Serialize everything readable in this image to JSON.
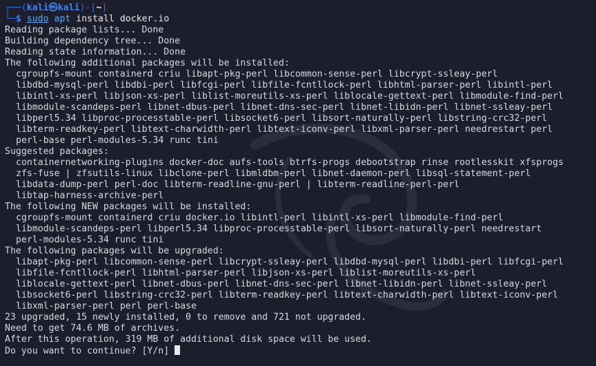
{
  "prompt": {
    "corner_top": "┌──(",
    "user": "kali",
    "at": "㉿",
    "host": "kali",
    "sep": ")-[",
    "dir": "~",
    "close": "]",
    "corner_bottom": "└─",
    "dollar": "$"
  },
  "command": {
    "sudo": "sudo",
    "apt": "apt",
    "rest": "install docker.io"
  },
  "output_lines": [
    {
      "text": "Reading package lists... Done",
      "indent": false
    },
    {
      "text": "Building dependency tree... Done",
      "indent": false
    },
    {
      "text": "Reading state information... Done",
      "indent": false
    },
    {
      "text": "The following additional packages will be installed:",
      "indent": false
    },
    {
      "text": "cgroupfs-mount containerd criu libapt-pkg-perl libcommon-sense-perl libcrypt-ssleay-perl",
      "indent": true
    },
    {
      "text": "libdbd-mysql-perl libdbi-perl libfcgi-perl libfile-fcntllock-perl libhtml-parser-perl libintl-perl",
      "indent": true
    },
    {
      "text": "libintl-xs-perl libjson-xs-perl liblist-moreutils-xs-perl liblocale-gettext-perl libmodule-find-perl",
      "indent": true
    },
    {
      "text": "libmodule-scandeps-perl libnet-dbus-perl libnet-dns-sec-perl libnet-libidn-perl libnet-ssleay-perl",
      "indent": true
    },
    {
      "text": "libperl5.34 libproc-processtable-perl libsocket6-perl libsort-naturally-perl libstring-crc32-perl",
      "indent": true
    },
    {
      "text": "libterm-readkey-perl libtext-charwidth-perl libtext-iconv-perl libxml-parser-perl needrestart perl",
      "indent": true
    },
    {
      "text": "perl-base perl-modules-5.34 runc tini",
      "indent": true
    },
    {
      "text": "Suggested packages:",
      "indent": false
    },
    {
      "text": "containernetworking-plugins docker-doc aufs-tools btrfs-progs debootstrap rinse rootlesskit xfsprogs",
      "indent": true
    },
    {
      "text": "zfs-fuse | zfsutils-linux libclone-perl libmldbm-perl libnet-daemon-perl libsql-statement-perl",
      "indent": true
    },
    {
      "text": "libdata-dump-perl perl-doc libterm-readline-gnu-perl | libterm-readline-perl-perl",
      "indent": true
    },
    {
      "text": "libtap-harness-archive-perl",
      "indent": true
    },
    {
      "text": "The following NEW packages will be installed:",
      "indent": false
    },
    {
      "text": "cgroupfs-mount containerd criu docker.io libintl-perl libintl-xs-perl libmodule-find-perl",
      "indent": true
    },
    {
      "text": "libmodule-scandeps-perl libperl5.34 libproc-processtable-perl libsort-naturally-perl needrestart",
      "indent": true
    },
    {
      "text": "perl-modules-5.34 runc tini",
      "indent": true
    },
    {
      "text": "The following packages will be upgraded:",
      "indent": false
    },
    {
      "text": "libapt-pkg-perl libcommon-sense-perl libcrypt-ssleay-perl libdbd-mysql-perl libdbi-perl libfcgi-perl",
      "indent": true
    },
    {
      "text": "libfile-fcntllock-perl libhtml-parser-perl libjson-xs-perl liblist-moreutils-xs-perl",
      "indent": true
    },
    {
      "text": "liblocale-gettext-perl libnet-dbus-perl libnet-dns-sec-perl libnet-libidn-perl libnet-ssleay-perl",
      "indent": true
    },
    {
      "text": "libsocket6-perl libstring-crc32-perl libterm-readkey-perl libtext-charwidth-perl libtext-iconv-perl",
      "indent": true
    },
    {
      "text": "libxml-parser-perl perl perl-base",
      "indent": true
    },
    {
      "text": "23 upgraded, 15 newly installed, 0 to remove and 721 not upgraded.",
      "indent": false
    },
    {
      "text": "Need to get 74.6 MB of archives.",
      "indent": false
    },
    {
      "text": "After this operation, 319 MB of additional disk space will be used.",
      "indent": false
    }
  ],
  "final_prompt": "Do you want to continue? [Y/n] ",
  "colors": {
    "background": "#1d1e2b",
    "text": "#d7d9e0",
    "prompt_frame": "#2f6bd6",
    "prompt_user": "#3f82f2",
    "command": "#5fa8f0"
  },
  "icons": {
    "watermark": "kali-dragon-icon",
    "cursor": "block-cursor-icon"
  }
}
